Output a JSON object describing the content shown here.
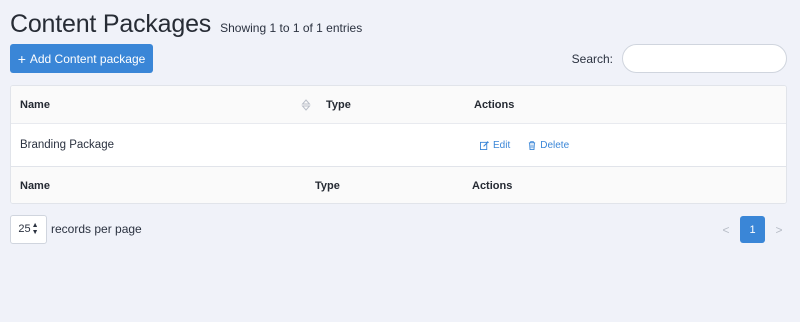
{
  "header": {
    "title": "Content Packages",
    "entries_info": "Showing 1 to 1 of 1 entries"
  },
  "toolbar": {
    "add_label": "Add Content package",
    "add_icon": "plus-icon",
    "search_label": "Search:",
    "search_value": "",
    "search_placeholder": ""
  },
  "table": {
    "columns": [
      "Name",
      "Type",
      "Actions"
    ],
    "rows": [
      {
        "name": "Branding Package",
        "type": "",
        "actions": [
          "Edit",
          "Delete"
        ]
      }
    ],
    "footer": [
      "Name",
      "Type",
      "Actions"
    ]
  },
  "pagination": {
    "per_page": "25",
    "per_page_label": "records per page",
    "prev": "<",
    "current_page": "1",
    "next": ">"
  },
  "colors": {
    "accent": "#3a86d7",
    "background": "#f0f2f9"
  }
}
